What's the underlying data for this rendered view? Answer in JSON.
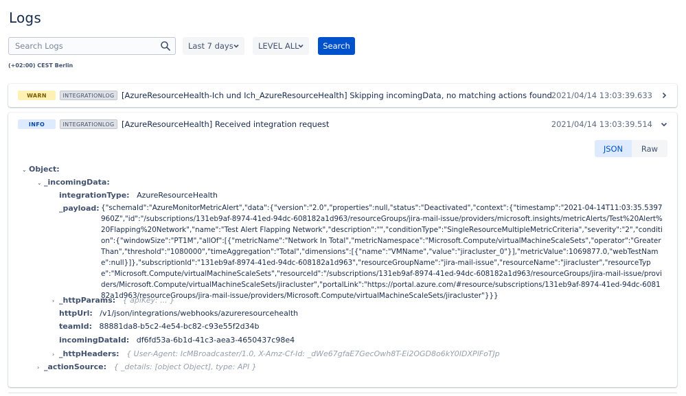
{
  "page": {
    "title": "Logs",
    "timezone": "(+02:00) CEST Berlin"
  },
  "toolbar": {
    "search_placeholder": "Search Logs",
    "time_range": "Last 7 days",
    "level": "LEVEL ALL",
    "search_button": "Search"
  },
  "logs": [
    {
      "level": "WARN",
      "type": "INTEGRATIONLOG",
      "message": "[AzureResourceHealth-Ich und Ich_AzureResourceHealth] Skipping incomingData, no matching actions found",
      "timestamp": "2021/04/14 13:03:39.633",
      "expanded": false
    },
    {
      "level": "INFO",
      "type": "INTEGRATIONLOG",
      "message": "[AzureResourceHealth] Received integration request",
      "timestamp": "2021/04/14 13:03:39.514",
      "expanded": true
    }
  ],
  "detail": {
    "view_json": "JSON",
    "view_raw": "Raw",
    "object_label": "Object:",
    "incoming_key": "_incomingData:",
    "integration_type_key": "integrationType:",
    "integration_type_val": "AzureResourceHealth",
    "payload_key": "_payload:",
    "payload_val": "{\"schemaId\":\"AzureMonitorMetricAlert\",\"data\":{\"version\":\"2.0\",\"properties\":null,\"status\":\"Deactivated\",\"context\":{\"timestamp\":\"2021-04-14T11:03:35.5397960Z\",\"id\":\"/subscriptions/131eb9af-8974-41ed-94dc-608182a1d963/resourceGroups/jira-mail-issue/providers/microsoft.insights/metricAlerts/Test%20Alert%20Flapping%20Network\",\"name\":\"Test Alert Flapping Network\",\"description\":\"\",\"conditionType\":\"SingleResourceMultipleMetricCriteria\",\"severity\":\"2\",\"condition\":{\"windowSize\":\"PT1M\",\"allOf\":[{\"metricName\":\"Network In Total\",\"metricNamespace\":\"Microsoft.Compute/virtualMachineScaleSets\",\"operator\":\"GreaterThan\",\"threshold\":\"1080000\",\"timeAggregation\":\"Total\",\"dimensions\":[{\"name\":\"VMName\",\"value\":\"jiracluster_0\"}],\"metricValue\":1069877.0,\"webTestName\":null}]},\"subscriptionId\":\"131eb9af-8974-41ed-94dc-608182a1d963\",\"resourceGroupName\":\"jira-mail-issue\",\"resourceName\":\"jiracluster\",\"resourceType\":\"Microsoft.Compute/virtualMachineScaleSets\",\"resourceId\":\"/subscriptions/131eb9af-8974-41ed-94dc-608182a1d963/resourceGroups/jira-mail-issue/providers/Microsoft.Compute/virtualMachineScaleSets/jiracluster\",\"portalLink\":\"https://portal.azure.com/#resource/subscriptions/131eb9af-8974-41ed-94dc-608182a1d963/resourceGroups/jira-mail-issue/providers/Microsoft.Compute/virtualMachineScaleSets/jiracluster\"}}}",
    "http_params_key": "_httpParams:",
    "http_params_val": "{ apiKey: ... }",
    "http_url_key": "httpUrl:",
    "http_url_val": "/v1/json/integrations/webhooks/azureresourcehealth",
    "team_id_key": "teamId:",
    "team_id_val": "88881da8-b5c2-4e54-bc82-c93e55f2d34b",
    "incoming_data_id_key": "incomingDataId:",
    "incoming_data_id_val": "df6fd53a-6b1d-41c3-aea3-4650437c98e4",
    "http_headers_key": "_httpHeaders:",
    "http_headers_val": "{ User-Agent: IcMBroadcaster/1.0, X-Amz-Cf-Id: _dWe67gfaE7GecOwh8T-Ei2OGD8o6kY0IDXPlFoTJp",
    "action_source_key": "_actionSource:",
    "action_source_val": "{ _details: [object Object], type: API }"
  },
  "colors": {
    "primary": "#0052cc",
    "warn_badge": "#fff0b3",
    "info_badge": "#deebff"
  }
}
